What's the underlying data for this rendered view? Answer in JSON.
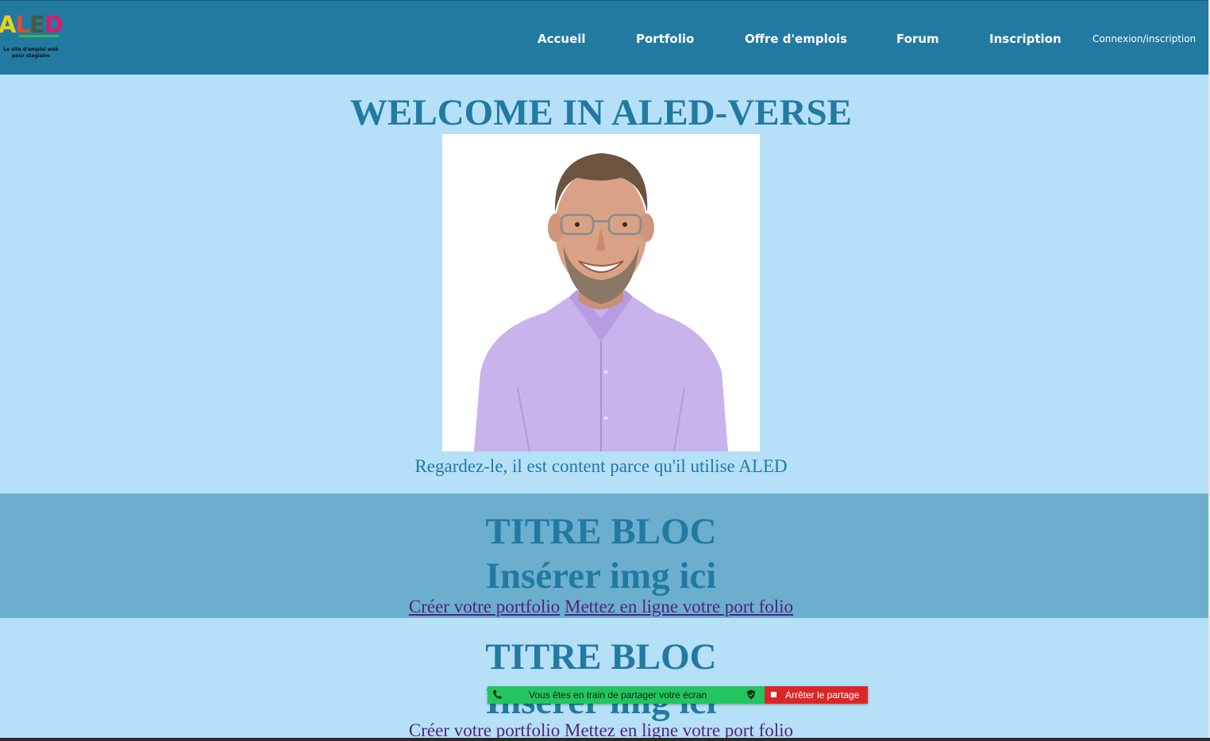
{
  "header": {
    "logo": {
      "letters": [
        "A",
        "L",
        "E",
        "D"
      ],
      "tagline_line1": "Le site d'emploi web",
      "tagline_line2": "pour stagiaire"
    },
    "nav": {
      "accueil": "Accueil",
      "portfolio": "Portfolio",
      "offres": "Offre d'emplois",
      "forum": "Forum",
      "inscription": "Inscription",
      "connexion": "Connexion/inscription"
    }
  },
  "hero": {
    "title": "WELCOME IN ALED-VERSE",
    "caption": "Regardez-le, il est content parce qu'il utilise ALED"
  },
  "blocks": [
    {
      "title": "TITRE BLOC",
      "subtitle": "Insérer img ici",
      "link_create": "Créer votre portfolio",
      "link_publish": "Mettez en ligne votre port folio"
    },
    {
      "title": "TITRE BLOC",
      "subtitle": "Insérer img ici",
      "link_create": "Créer votre portfolio",
      "link_publish": "Mettez en ligne votre port folio"
    }
  ],
  "share_bar": {
    "message": "Vous êtes en train de partager votre écran",
    "stop_label": "Arrêter le partage"
  },
  "colors": {
    "header_bg": "#227aa1",
    "page_bg": "#b5e0f8",
    "block_bg": "#6caecd",
    "heading": "#227aa1",
    "link": "#52237f",
    "share_green": "#22c55e",
    "share_red": "#dc2626"
  }
}
